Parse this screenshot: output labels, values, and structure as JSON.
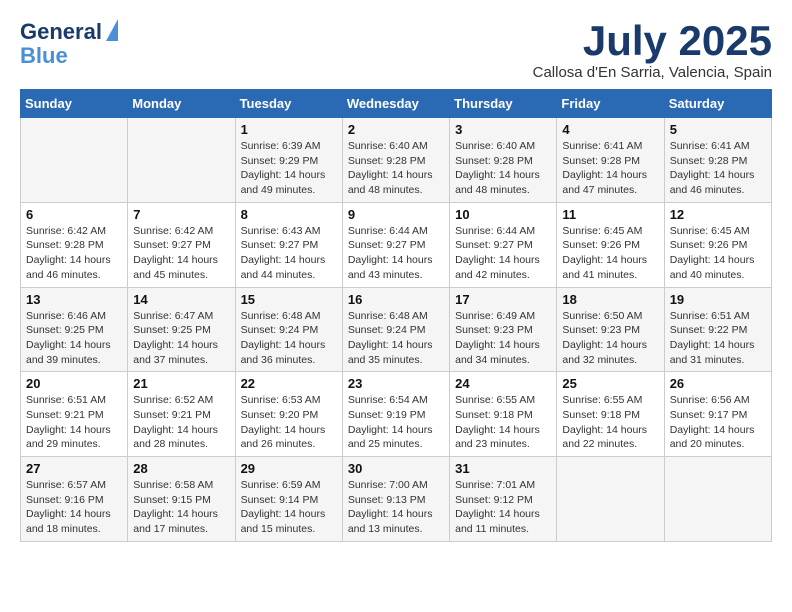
{
  "header": {
    "logo_line1": "General",
    "logo_line2": "Blue",
    "month": "July 2025",
    "location": "Callosa d'En Sarria, Valencia, Spain"
  },
  "weekdays": [
    "Sunday",
    "Monday",
    "Tuesday",
    "Wednesday",
    "Thursday",
    "Friday",
    "Saturday"
  ],
  "weeks": [
    [
      {
        "day": "",
        "info": ""
      },
      {
        "day": "",
        "info": ""
      },
      {
        "day": "1",
        "info": "Sunrise: 6:39 AM\nSunset: 9:29 PM\nDaylight: 14 hours and 49 minutes."
      },
      {
        "day": "2",
        "info": "Sunrise: 6:40 AM\nSunset: 9:28 PM\nDaylight: 14 hours and 48 minutes."
      },
      {
        "day": "3",
        "info": "Sunrise: 6:40 AM\nSunset: 9:28 PM\nDaylight: 14 hours and 48 minutes."
      },
      {
        "day": "4",
        "info": "Sunrise: 6:41 AM\nSunset: 9:28 PM\nDaylight: 14 hours and 47 minutes."
      },
      {
        "day": "5",
        "info": "Sunrise: 6:41 AM\nSunset: 9:28 PM\nDaylight: 14 hours and 46 minutes."
      }
    ],
    [
      {
        "day": "6",
        "info": "Sunrise: 6:42 AM\nSunset: 9:28 PM\nDaylight: 14 hours and 46 minutes."
      },
      {
        "day": "7",
        "info": "Sunrise: 6:42 AM\nSunset: 9:27 PM\nDaylight: 14 hours and 45 minutes."
      },
      {
        "day": "8",
        "info": "Sunrise: 6:43 AM\nSunset: 9:27 PM\nDaylight: 14 hours and 44 minutes."
      },
      {
        "day": "9",
        "info": "Sunrise: 6:44 AM\nSunset: 9:27 PM\nDaylight: 14 hours and 43 minutes."
      },
      {
        "day": "10",
        "info": "Sunrise: 6:44 AM\nSunset: 9:27 PM\nDaylight: 14 hours and 42 minutes."
      },
      {
        "day": "11",
        "info": "Sunrise: 6:45 AM\nSunset: 9:26 PM\nDaylight: 14 hours and 41 minutes."
      },
      {
        "day": "12",
        "info": "Sunrise: 6:45 AM\nSunset: 9:26 PM\nDaylight: 14 hours and 40 minutes."
      }
    ],
    [
      {
        "day": "13",
        "info": "Sunrise: 6:46 AM\nSunset: 9:25 PM\nDaylight: 14 hours and 39 minutes."
      },
      {
        "day": "14",
        "info": "Sunrise: 6:47 AM\nSunset: 9:25 PM\nDaylight: 14 hours and 37 minutes."
      },
      {
        "day": "15",
        "info": "Sunrise: 6:48 AM\nSunset: 9:24 PM\nDaylight: 14 hours and 36 minutes."
      },
      {
        "day": "16",
        "info": "Sunrise: 6:48 AM\nSunset: 9:24 PM\nDaylight: 14 hours and 35 minutes."
      },
      {
        "day": "17",
        "info": "Sunrise: 6:49 AM\nSunset: 9:23 PM\nDaylight: 14 hours and 34 minutes."
      },
      {
        "day": "18",
        "info": "Sunrise: 6:50 AM\nSunset: 9:23 PM\nDaylight: 14 hours and 32 minutes."
      },
      {
        "day": "19",
        "info": "Sunrise: 6:51 AM\nSunset: 9:22 PM\nDaylight: 14 hours and 31 minutes."
      }
    ],
    [
      {
        "day": "20",
        "info": "Sunrise: 6:51 AM\nSunset: 9:21 PM\nDaylight: 14 hours and 29 minutes."
      },
      {
        "day": "21",
        "info": "Sunrise: 6:52 AM\nSunset: 9:21 PM\nDaylight: 14 hours and 28 minutes."
      },
      {
        "day": "22",
        "info": "Sunrise: 6:53 AM\nSunset: 9:20 PM\nDaylight: 14 hours and 26 minutes."
      },
      {
        "day": "23",
        "info": "Sunrise: 6:54 AM\nSunset: 9:19 PM\nDaylight: 14 hours and 25 minutes."
      },
      {
        "day": "24",
        "info": "Sunrise: 6:55 AM\nSunset: 9:18 PM\nDaylight: 14 hours and 23 minutes."
      },
      {
        "day": "25",
        "info": "Sunrise: 6:55 AM\nSunset: 9:18 PM\nDaylight: 14 hours and 22 minutes."
      },
      {
        "day": "26",
        "info": "Sunrise: 6:56 AM\nSunset: 9:17 PM\nDaylight: 14 hours and 20 minutes."
      }
    ],
    [
      {
        "day": "27",
        "info": "Sunrise: 6:57 AM\nSunset: 9:16 PM\nDaylight: 14 hours and 18 minutes."
      },
      {
        "day": "28",
        "info": "Sunrise: 6:58 AM\nSunset: 9:15 PM\nDaylight: 14 hours and 17 minutes."
      },
      {
        "day": "29",
        "info": "Sunrise: 6:59 AM\nSunset: 9:14 PM\nDaylight: 14 hours and 15 minutes."
      },
      {
        "day": "30",
        "info": "Sunrise: 7:00 AM\nSunset: 9:13 PM\nDaylight: 14 hours and 13 minutes."
      },
      {
        "day": "31",
        "info": "Sunrise: 7:01 AM\nSunset: 9:12 PM\nDaylight: 14 hours and 11 minutes."
      },
      {
        "day": "",
        "info": ""
      },
      {
        "day": "",
        "info": ""
      }
    ]
  ]
}
